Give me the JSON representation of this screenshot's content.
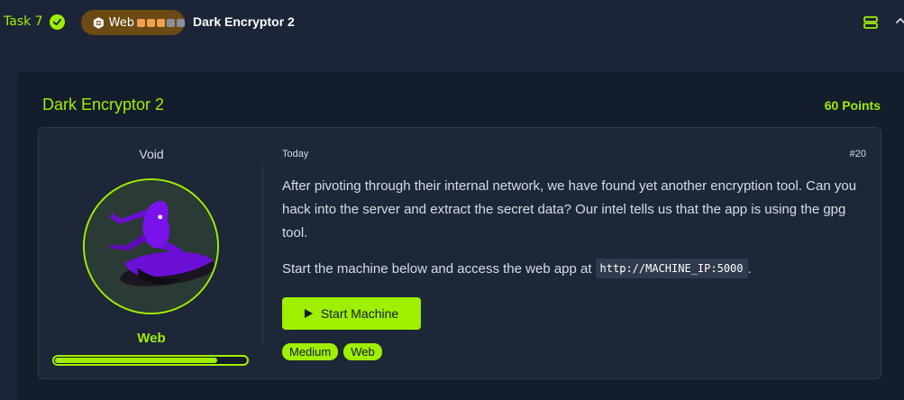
{
  "topbar": {
    "task_label": "Task 7",
    "pill": {
      "label": "Web",
      "difficulty_dots": [
        "#f0a050",
        "#f0a050",
        "#f0a050",
        "#8a8f99",
        "#8a8f99"
      ]
    },
    "room_title": "Dark Encryptor 2"
  },
  "panel": {
    "title": "Dark Encryptor 2",
    "points": "60 Points"
  },
  "author": {
    "name": "Void",
    "category": "Web",
    "progress_fraction": 0.85
  },
  "challenge": {
    "date": "Today",
    "number": "#20",
    "description": "After pivoting through their internal network, we have found yet another encryption tool. Can you hack into the server and extract the secret data? Our intel tells us that the app is using the gpg tool.",
    "start_text": "Start the machine below and access the web app at",
    "url": "http://MACHINE_IP:5000",
    "start_suffix": ".",
    "start_button": "Start Machine",
    "tags": [
      "Medium",
      "Web"
    ]
  },
  "colors": {
    "accent": "#9fef00",
    "background": "#1c2538",
    "panel": "#141d2b",
    "card": "#1e2738"
  }
}
